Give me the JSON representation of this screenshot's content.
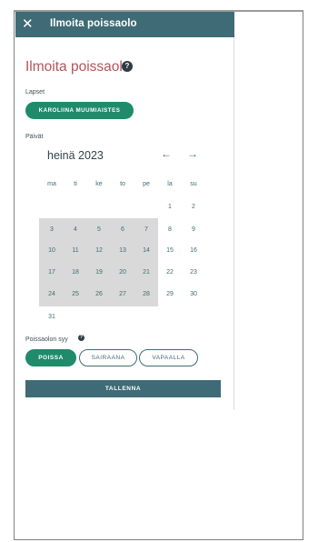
{
  "topbar": {
    "close_icon": "close-icon",
    "title": "Ilmoita poissaolo"
  },
  "heading": {
    "title": "Ilmoita poissaolo",
    "help": "?"
  },
  "children": {
    "label": "Lapset",
    "chip": "KAROLIINA MUUMIAISTES"
  },
  "days": {
    "label": "Päivät",
    "month": "heinä 2023",
    "prev": "←",
    "next": "→",
    "weekdays": [
      "ma",
      "ti",
      "ke",
      "to",
      "pe",
      "la",
      "su"
    ],
    "dates": [
      "1",
      "2",
      "3",
      "4",
      "5",
      "6",
      "7",
      "8",
      "9",
      "10",
      "11",
      "12",
      "13",
      "14",
      "15",
      "16",
      "17",
      "18",
      "19",
      "20",
      "21",
      "22",
      "23",
      "24",
      "25",
      "26",
      "27",
      "28",
      "29",
      "30",
      "31"
    ]
  },
  "absence": {
    "label": "Poissaolon syy",
    "help": "?",
    "options": [
      "POISSA",
      "SAIRAANA",
      "VAPAALLA"
    ],
    "selected": "POISSA"
  },
  "save_label": "TALLENNA",
  "colors": {
    "header": "#3e6b75",
    "accent_green": "#1f8b6b",
    "heading_red": "#b4535a",
    "selected_days": "#d9d9d9"
  }
}
